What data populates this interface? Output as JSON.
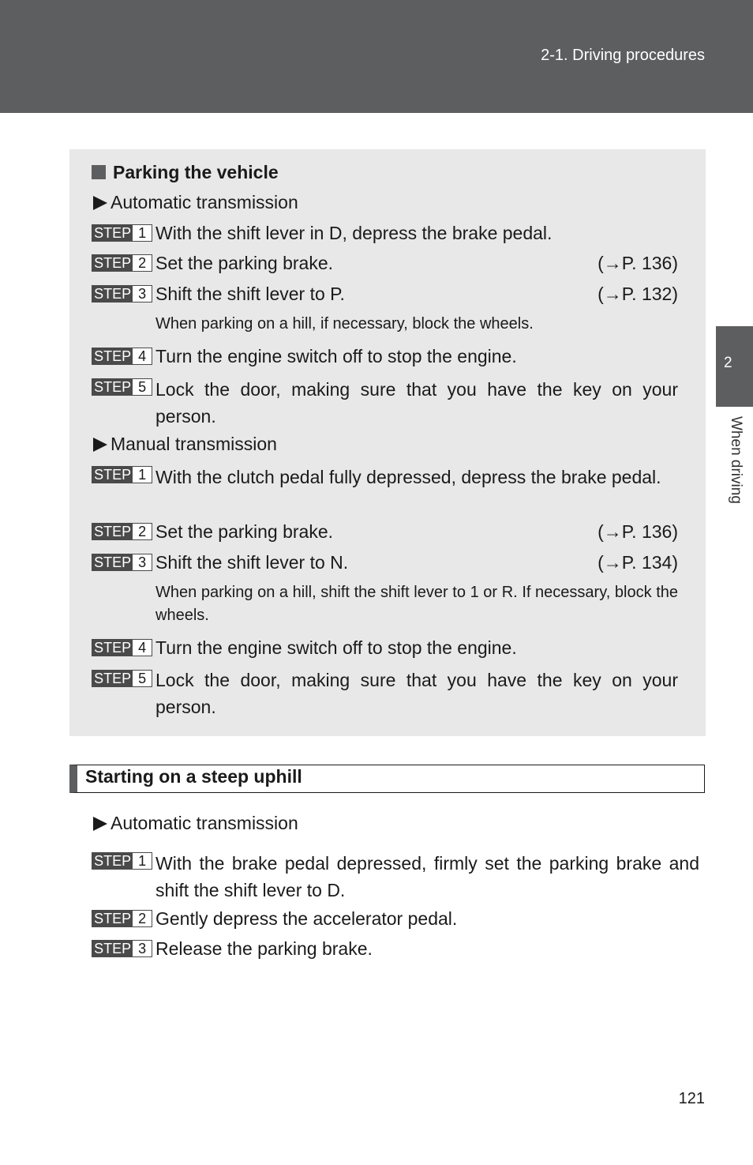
{
  "header": {
    "section": "2-1. Driving procedures"
  },
  "side_tab": {
    "chapter_number": "2",
    "chapter_title": "When driving"
  },
  "parking": {
    "title": "Parking the vehicle",
    "automatic": {
      "label": "Automatic transmission",
      "steps": [
        {
          "word": "STEP",
          "num": "1",
          "text": "With the shift lever in D, depress the brake pedal.",
          "ref": ""
        },
        {
          "word": "STEP",
          "num": "2",
          "text": "Set the parking brake.",
          "ref": "(→P. 136)"
        },
        {
          "word": "STEP",
          "num": "3",
          "text": "Shift the shift lever to P.",
          "ref": "(→P. 132)"
        },
        {
          "word": "STEP",
          "num": "4",
          "text": "Turn the engine switch off to stop the engine.",
          "ref": ""
        },
        {
          "word": "STEP",
          "num": "5",
          "text": "Lock the door, making sure that you have the key on your person.",
          "ref": ""
        }
      ],
      "note": "When parking on a hill, if necessary, block the wheels."
    },
    "manual": {
      "label": "Manual transmission",
      "steps": [
        {
          "word": "STEP",
          "num": "1",
          "text": "With the clutch pedal fully depressed, depress the brake pedal.",
          "ref": ""
        },
        {
          "word": "STEP",
          "num": "2",
          "text": "Set the parking brake.",
          "ref": "(→P. 136)"
        },
        {
          "word": "STEP",
          "num": "3",
          "text": "Shift the shift lever to N.",
          "ref": "(→P. 134)"
        },
        {
          "word": "STEP",
          "num": "4",
          "text": "Turn the engine switch off to stop the engine.",
          "ref": ""
        },
        {
          "word": "STEP",
          "num": "5",
          "text": "Lock the door, making sure that you have the key on your person.",
          "ref": ""
        }
      ],
      "note": "When parking on a hill, shift the shift lever to 1 or R. If necessary, block the wheels."
    }
  },
  "uphill": {
    "title": "Starting on a steep uphill",
    "automatic": {
      "label": "Automatic transmission",
      "steps": [
        {
          "word": "STEP",
          "num": "1",
          "text": "With the brake pedal depressed, firmly set the parking brake and shift the shift lever to D."
        },
        {
          "word": "STEP",
          "num": "2",
          "text": "Gently depress the accelerator pedal."
        },
        {
          "word": "STEP",
          "num": "3",
          "text": "Release the parking brake."
        }
      ]
    }
  },
  "footer": {
    "page_number": "121"
  }
}
